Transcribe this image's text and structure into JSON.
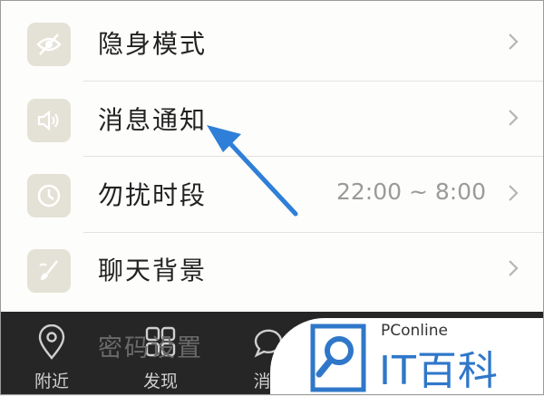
{
  "settings": {
    "items": [
      {
        "label": "隐身模式",
        "value": "",
        "icon": "eye-off-icon"
      },
      {
        "label": "消息通知",
        "value": "",
        "icon": "speaker-icon"
      },
      {
        "label": "勿扰时段",
        "value": "22:00 ~ 8:00",
        "icon": "clock-icon"
      },
      {
        "label": "聊天背景",
        "value": "",
        "icon": "brush-icon"
      }
    ],
    "partial_item": "密码设置"
  },
  "tabbar": {
    "tabs": [
      {
        "label": "附近",
        "icon": "location-pin-icon"
      },
      {
        "label": "发现",
        "icon": "grid-icon"
      },
      {
        "label": "消",
        "icon": "chat-bubble-icon"
      }
    ]
  },
  "watermark": {
    "brand_small": "PConline",
    "brand_large": "IT百科"
  },
  "colors": {
    "arrow": "#2f7fd8",
    "icon_bg": "#e4e2d6",
    "tabbar_bg": "#262626",
    "brand_blue": "#2f77c9"
  }
}
